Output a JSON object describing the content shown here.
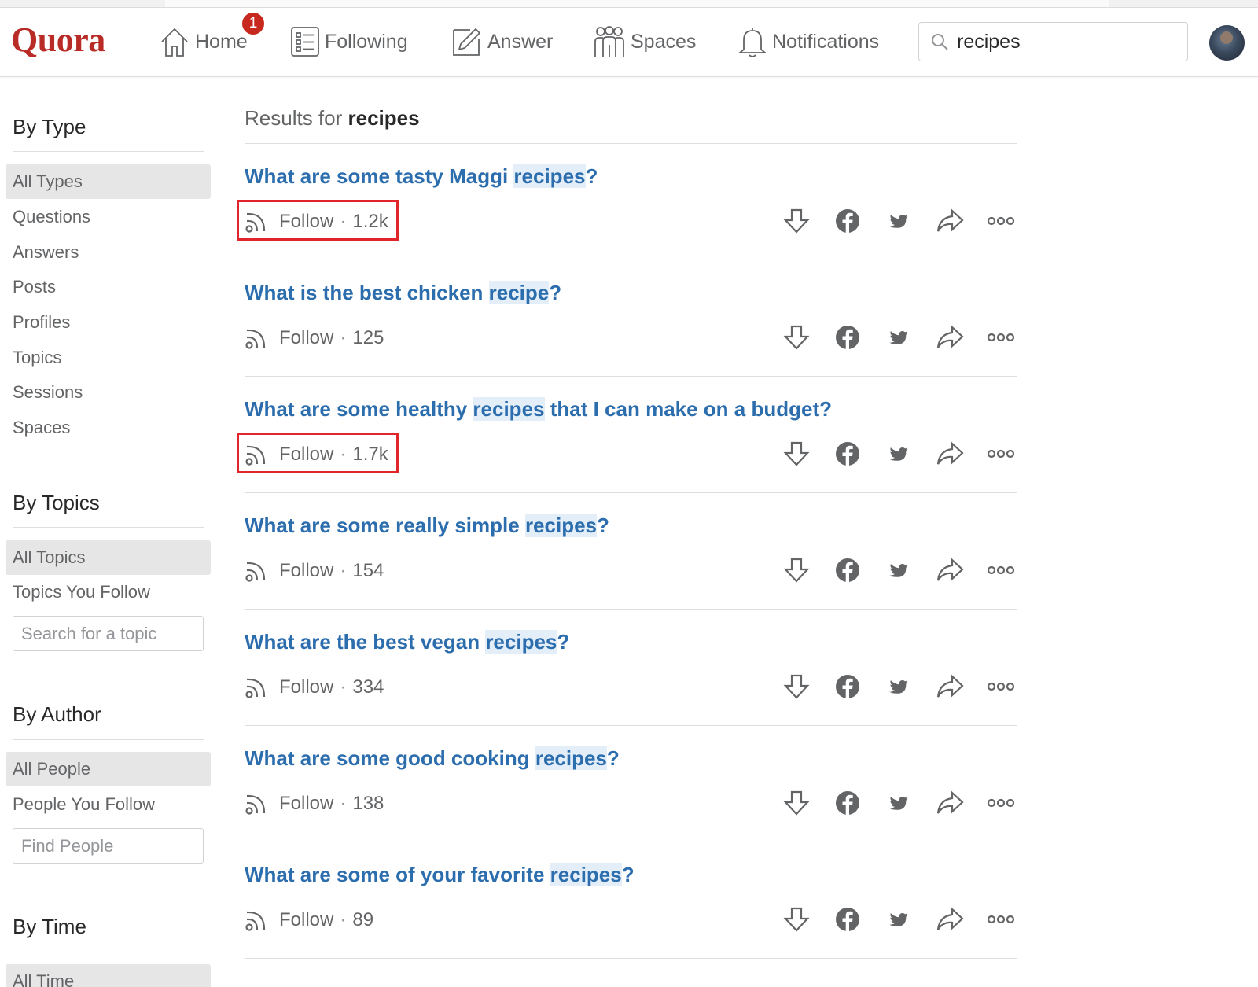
{
  "app": {
    "logo_text": "Quora",
    "brand_color": "#b92b27",
    "link_color": "#2b6dad"
  },
  "nav": {
    "home": {
      "label": "Home",
      "icon": "home-icon",
      "badge": "1"
    },
    "following": {
      "label": "Following",
      "icon": "following-list-icon"
    },
    "answer": {
      "label": "Answer",
      "icon": "pencil-icon"
    },
    "spaces": {
      "label": "Spaces",
      "icon": "people-group-icon"
    },
    "notifications": {
      "label": "Notifications",
      "icon": "bell-icon"
    }
  },
  "search": {
    "value": "recipes",
    "icon": "search-icon"
  },
  "sidebar": {
    "by_type": {
      "heading": "By Type",
      "items": [
        "All Types",
        "Questions",
        "Answers",
        "Posts",
        "Profiles",
        "Topics",
        "Sessions",
        "Spaces"
      ],
      "active": "All Types"
    },
    "by_topics": {
      "heading": "By Topics",
      "items": [
        "All Topics",
        "Topics You Follow"
      ],
      "active": "All Topics",
      "search_placeholder": "Search for a topic"
    },
    "by_author": {
      "heading": "By Author",
      "items": [
        "All People",
        "People You Follow"
      ],
      "active": "All People",
      "search_placeholder": "Find People"
    },
    "by_time": {
      "heading": "By Time",
      "items": [
        "All Time"
      ],
      "active": "All Time"
    }
  },
  "results": {
    "prefix": "Results for",
    "query": "recipes",
    "follow_label": "Follow",
    "items": [
      {
        "pre": "What are some tasty Maggi ",
        "hl": "recipes",
        "post": "?",
        "followers": "1.2k",
        "highlighted": true
      },
      {
        "pre": "What is the best chicken ",
        "hl": "recipe",
        "post": "?",
        "followers": "125",
        "highlighted": false
      },
      {
        "pre": "What are some healthy ",
        "hl": "recipes",
        "post": " that I can make on a budget?",
        "followers": "1.7k",
        "highlighted": true
      },
      {
        "pre": "What are some really simple ",
        "hl": "recipes",
        "post": "?",
        "followers": "154",
        "highlighted": false
      },
      {
        "pre": "What are the best vegan ",
        "hl": "recipes",
        "post": "?",
        "followers": "334",
        "highlighted": false
      },
      {
        "pre": "What are some good cooking ",
        "hl": "recipes",
        "post": "?",
        "followers": "138",
        "highlighted": false
      },
      {
        "pre": "What are some of your favorite ",
        "hl": "recipes",
        "post": "?",
        "followers": "89",
        "highlighted": false
      }
    ],
    "action_icons": [
      "downvote-arrow-icon",
      "facebook-icon",
      "twitter-icon",
      "share-arrow-icon",
      "more-options-icon"
    ]
  }
}
